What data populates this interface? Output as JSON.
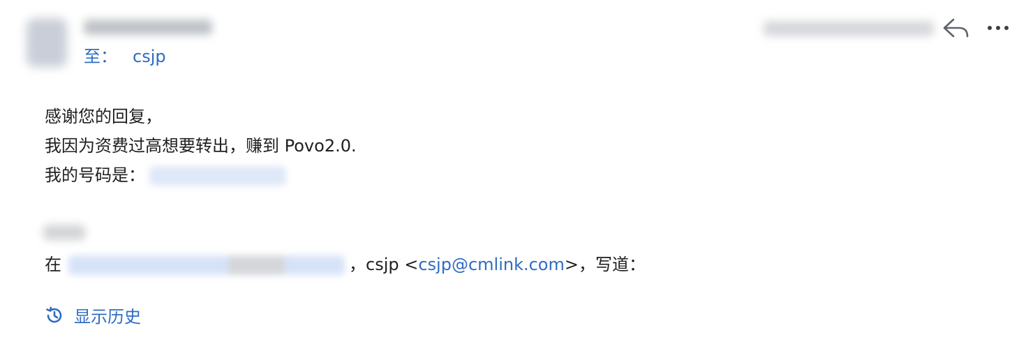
{
  "header": {
    "to_label": "至：",
    "recipient": "csjp"
  },
  "body": {
    "lines": [
      "感谢您的回复，",
      "我因为资费过高想要转出，赚到 Povo2.0.",
      "我的号码是："
    ]
  },
  "quote": {
    "prefix": "在",
    "sender_name": "，csjp <",
    "sender_email": "csjp@cmlink.com",
    "suffix": ">，写道："
  },
  "history": {
    "label": "显示历史",
    "icon": "history-icon"
  },
  "actions": {
    "reply_icon": "reply-icon",
    "more_icon": "more-horizontal-icon"
  },
  "colors": {
    "link": "#2f6cc2",
    "text": "#1f1f1f",
    "icon": "#5f6368"
  }
}
